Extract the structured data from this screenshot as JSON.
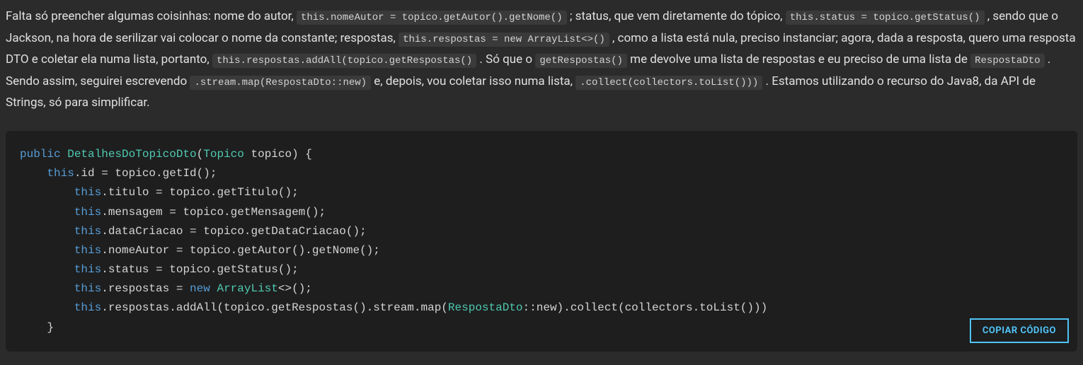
{
  "paragraph": {
    "t1": "Falta só preencher algumas coisinhas: nome do autor, ",
    "c1": "this.nomeAutor = topico.getAutor().getNome()",
    "t2": " ; status, que vem diretamente do tópico, ",
    "c2": "this.status = topico.getStatus()",
    "t3": " , sendo que o Jackson, na hora de serilizar vai colocar o nome da constante; respostas, ",
    "c3": "this.respostas = new ArrayList<>()",
    "t4": " , como a lista está nula, preciso instanciar; agora, dada a resposta, quero uma resposta DTO e coletar ela numa lista, portanto, ",
    "c4": "this.respostas.addAll(topico.getRespostas()",
    "t5": " . Só que o ",
    "c5": "getRespostas()",
    "t6": " me devolve uma lista de respostas e eu preciso de uma lista de ",
    "c6": "RespostaDto",
    "t7": " . Sendo assim, seguirei escrevendo ",
    "c7": ".stream.map(RespostaDto::new)",
    "t8": " e, depois, vou coletar isso numa lista, ",
    "c8": ".collect(collectors.toList()))",
    "t9": " . Estamos utilizando o recurso do Java8, da API de Strings, só para simplificar."
  },
  "code": {
    "kw_public": "public",
    "ctor_name": "DetalhesDoTopicoDto",
    "param_type": "Topico",
    "param_name": "topico",
    "kw_this": "this",
    "kw_new": "new",
    "arraylist": "ArrayList",
    "angle_empty": "<>()",
    "resposta_dto": "RespostaDto",
    "dcolon_new": "::new",
    "l1_prop": ".id = topico.getId();",
    "l2_prop": ".titulo = topico.getTitulo();",
    "l3_prop": ".mensagem = topico.getMensagem();",
    "l4_prop": ".dataCriacao = topico.getDataCriacao();",
    "l5_prop": ".nomeAutor = topico.getAutor().getNome();",
    "l6_prop": ".status = topico.getStatus();",
    "l7_prop": ".respostas = ",
    "l7_semi": ";",
    "l8_a": ".respostas.addAll(topico.getRespostas().stream.map(",
    "l8_b": ").collect(collectors.toList()))",
    "open_brace": " {",
    "close_brace": "}",
    "open_paren": "(",
    "close_paren": ")"
  },
  "copy_button_label": "COPIAR CÓDIGO"
}
